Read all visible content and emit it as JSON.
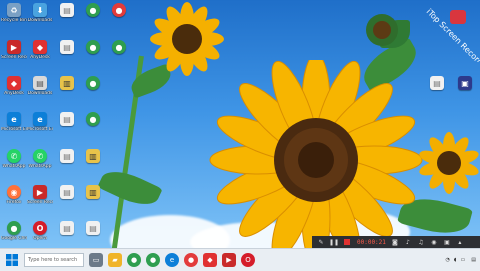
{
  "desktop_icons": [
    {
      "label": "Recycle Bin",
      "color": "#7aa0c4",
      "glyph": "♻"
    },
    {
      "label": "Downloads",
      "color": "#4aa3df",
      "glyph": "⬇"
    },
    {
      "label": "Google Chrome",
      "color": "#2f9e4f",
      "glyph": "●"
    },
    {
      "label": "iTop Screen Recorder",
      "color": "#e23b3b",
      "glyph": "●"
    },
    {
      "label": "Screen Recorder",
      "color": "#c92a2a",
      "glyph": "▶"
    },
    {
      "label": "AnyDesk",
      "color": "#e03131",
      "glyph": "◆"
    },
    {
      "label": "WhatsApp",
      "color": "#25d366",
      "glyph": "✆"
    },
    {
      "label": "Firefox",
      "color": "#ff7139",
      "glyph": "◉"
    },
    {
      "label": "Microsoft Edge",
      "color": "#0c7fd8",
      "glyph": "e"
    },
    {
      "label": "Opera",
      "color": "#d51d2a",
      "glyph": "O"
    }
  ],
  "taskbar": {
    "search_placeholder": "Type here to search"
  },
  "recorder": {
    "time": "00:00:21"
  },
  "watermark": {
    "text": "iTop Screen Recorder"
  }
}
